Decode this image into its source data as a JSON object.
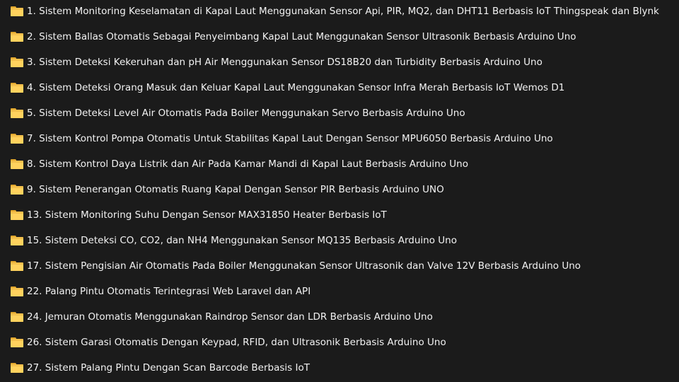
{
  "folders": [
    {
      "label": "1. Sistem Monitoring Keselamatan di Kapal Laut Menggunakan Sensor Api, PIR, MQ2, dan DHT11 Berbasis IoT Thingspeak dan Blynk",
      "icon": "folder-icon"
    },
    {
      "label": "2. Sistem Ballas Otomatis Sebagai Penyeimbang Kapal Laut Menggunakan Sensor Ultrasonik Berbasis Arduino Uno",
      "icon": "folder-icon"
    },
    {
      "label": "3. Sistem Deteksi Kekeruhan dan pH Air Menggunakan Sensor DS18B20 dan Turbidity Berbasis Arduino Uno",
      "icon": "folder-icon"
    },
    {
      "label": "4. Sistem Deteksi Orang Masuk dan Keluar Kapal Laut Menggunakan Sensor Infra Merah Berbasis IoT Wemos D1",
      "icon": "folder-icon"
    },
    {
      "label": "5. Sistem Deteksi Level Air Otomatis Pada Boiler Menggunakan Servo Berbasis Arduino Uno",
      "icon": "folder-icon"
    },
    {
      "label": "7. Sistem Kontrol Pompa Otomatis Untuk Stabilitas Kapal Laut Dengan Sensor MPU6050 Berbasis Arduino Uno",
      "icon": "folder-icon"
    },
    {
      "label": "8. Sistem Kontrol Daya Listrik dan Air Pada Kamar Mandi di Kapal Laut Berbasis Arduino Uno",
      "icon": "folder-icon"
    },
    {
      "label": "9. Sistem Penerangan Otomatis Ruang Kapal Dengan Sensor PIR Berbasis Arduino UNO",
      "icon": "folder-icon"
    },
    {
      "label": "13. Sistem Monitoring Suhu Dengan Sensor MAX31850 Heater Berbasis IoT",
      "icon": "folder-icon"
    },
    {
      "label": "15. Sistem Deteksi CO, CO2, dan NH4 Menggunakan Sensor MQ135 Berbasis Arduino Uno",
      "icon": "folder-icon"
    },
    {
      "label": "17. Sistem Pengisian Air Otomatis Pada Boiler Menggunakan Sensor Ultrasonik dan Valve 12V Berbasis Arduino Uno",
      "icon": "folder-icon"
    },
    {
      "label": "22. Palang Pintu Otomatis Terintegrasi Web Laravel dan API",
      "icon": "folder-icon"
    },
    {
      "label": "24. Jemuran Otomatis Menggunakan Raindrop Sensor dan LDR Berbasis Arduino Uno",
      "icon": "folder-icon"
    },
    {
      "label": "26. Sistem Garasi Otomatis Dengan Keypad, RFID, dan Ultrasonik Berbasis Arduino Uno",
      "icon": "folder-icon"
    },
    {
      "label": "27. Sistem Palang Pintu Dengan Scan Barcode Berbasis IoT",
      "icon": "folder-icon"
    }
  ]
}
